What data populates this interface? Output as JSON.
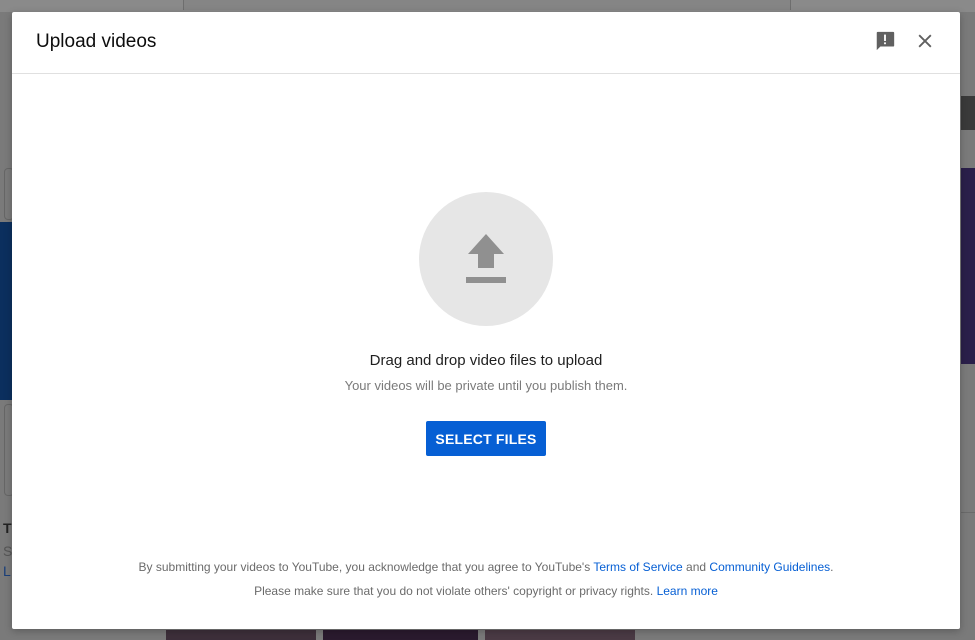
{
  "dialog": {
    "title": "Upload videos",
    "feedback_icon": "feedback-icon",
    "close_icon": "close-icon"
  },
  "upload": {
    "icon": "upload-arrow-icon",
    "drag_text": "Drag and drop video files to upload",
    "private_text": "Your videos will be private until you publish them.",
    "select_button_label": "SELECT FILES"
  },
  "footer": {
    "line1_prefix": "By submitting your videos to YouTube, you acknowledge that you agree to YouTube's ",
    "terms_link": "Terms of Service",
    "line1_and": " and ",
    "guidelines_link": "Community Guidelines",
    "line1_suffix": ".",
    "line2_text": "Please make sure that you do not violate others' copyright or privacy rights. ",
    "learn_more_link": "Learn more"
  },
  "background": {
    "left_text_1": "T",
    "left_text_2": "S",
    "left_text_3": "L"
  },
  "colors": {
    "accent": "#065fd4",
    "overlay": "#7a7a7a",
    "upload_circle": "#e6e6e6"
  }
}
